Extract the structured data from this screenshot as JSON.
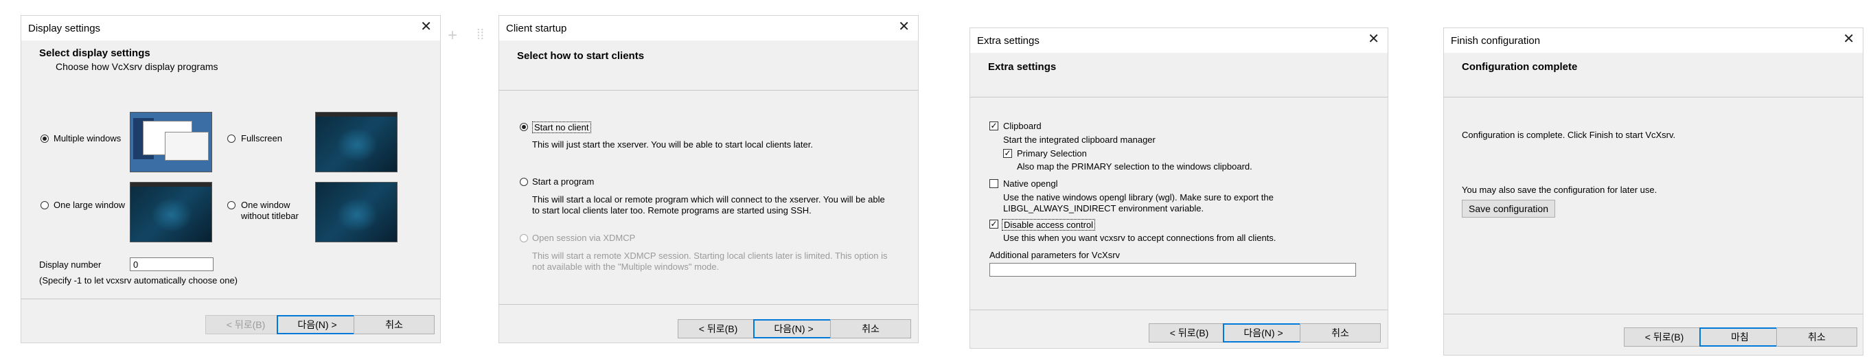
{
  "close_glyph": "✕",
  "dialogs": {
    "display": {
      "title": "Display settings",
      "header_title": "Select display settings",
      "header_sub": "Choose how VcXsrv display programs",
      "options": {
        "multiple": "Multiple windows",
        "fullscreen": "Fullscreen",
        "one_large": "One large window",
        "one_no_title_line1": "One window",
        "one_no_title_line2": "without titlebar"
      },
      "display_number_label": "Display number",
      "display_number_value": "0",
      "display_number_hint": "(Specify -1 to let vcxsrv automatically choose one)",
      "buttons": {
        "back": "< 뒤로(B)",
        "next": "다음(N) >",
        "cancel": "취소"
      }
    },
    "client": {
      "title": "Client startup",
      "header_title": "Select how to start clients",
      "options": {
        "no_client": "Start no client",
        "no_client_desc": "This will just start the xserver. You will be able to start local clients later.",
        "program": "Start a program",
        "program_desc": "This will start a local or remote program which will connect to the xserver. You will be able to start local clients later too. Remote programs are started using SSH.",
        "xdmcp": "Open session via XDMCP",
        "xdmcp_desc": "This will start a remote XDMCP session. Starting local clients later is limited. This option is not available with the \"Multiple windows\" mode."
      },
      "buttons": {
        "back": "< 뒤로(B)",
        "next": "다음(N) >",
        "cancel": "취소"
      }
    },
    "extra": {
      "title": "Extra settings",
      "header_title": "Extra settings",
      "clipboard": "Clipboard",
      "clipboard_desc": "Start the integrated clipboard manager",
      "primary": "Primary Selection",
      "primary_desc": "Also map the PRIMARY selection to the windows clipboard.",
      "opengl": "Native opengl",
      "opengl_desc1": "Use the native windows opengl library (wgl). Make sure to export the",
      "opengl_desc2": "LIBGL_ALWAYS_INDIRECT environment variable.",
      "access": "Disable access control",
      "access_desc": "Use this when you want vcxsrv to accept connections from all clients.",
      "params_label": "Additional parameters for VcXsrv",
      "params_value": "",
      "buttons": {
        "back": "< 뒤로(B)",
        "next": "다음(N) >",
        "cancel": "취소"
      }
    },
    "finish": {
      "title": "Finish configuration",
      "header_title": "Configuration complete",
      "complete_text": "Configuration is complete. Click Finish to start VcXsrv.",
      "save_text": "You may also save the configuration for later use.",
      "save_button": "Save configuration",
      "buttons": {
        "back": "< 뒤로(B)",
        "finish": "마침",
        "cancel": "취소"
      }
    }
  },
  "toolbar": {
    "plus_glyph": "+",
    "grip_glyph": "⁞⁞"
  },
  "checkmark": "✓"
}
